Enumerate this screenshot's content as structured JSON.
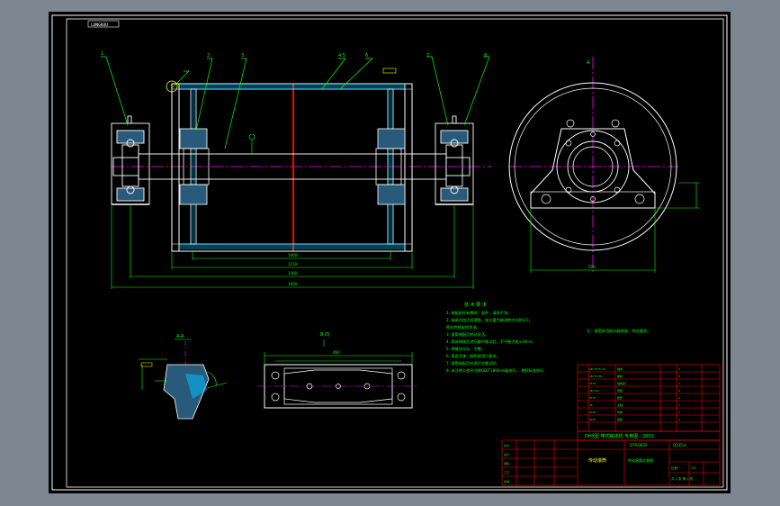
{
  "colors": {
    "background": "#7d8791",
    "canvas": "#000000",
    "frame": "#ffffff",
    "outline": "#ffffff",
    "leader": "#00ff00",
    "centerline": "#ff00ff",
    "hatch": "#00bfff",
    "cut_line": "#ff0000",
    "title_block_line": "#ff0000",
    "text": "#00ff00",
    "text_yellow": "#ffff00"
  },
  "sheet": {
    "corner_tag": "LONGKOU"
  },
  "views": {
    "side_view": {
      "section_mark": "A"
    },
    "detail_section": {
      "label": "A-A"
    },
    "bottom_view": {
      "label": "B 向"
    }
  },
  "technical_requirements": {
    "title": "技 术 要 求",
    "items": [
      "1. 装配前所有零件、部件，清洗干净。",
      "2. 轴承内加注润滑脂，加注量为轴承腔空间的2/3，",
      "   密封件装配时涂油。",
      "3. 滚筒装配后转动灵活。",
      "4. 筒体焊接后进行静平衡试验，不平衡力矩≤1N.m。",
      "5. 焊缝应均匀、平整。",
      "6. 表面涂漆，颜色按用户要求。",
      "7. 滚筒装配后应进行空载试验。",
      "8. 未注明公差尺寸按GB/T1804-m级执行，  按照标准执行  "
    ],
    "side_note": "注：滚筒采用双向轴承座，符合要求。"
  },
  "title_block": {
    "drawing_title": "DHX型 带式输送机 专用图 - 2002",
    "drawing_no": "DTII 0632",
    "part_name": "传动滚筒",
    "sheet_info": "共 1 张 第 1 张",
    "scale_label": "比例",
    "scale": "1:5",
    "material": "Q235-A",
    "design_note": "传动滚筒总装图"
  }
}
